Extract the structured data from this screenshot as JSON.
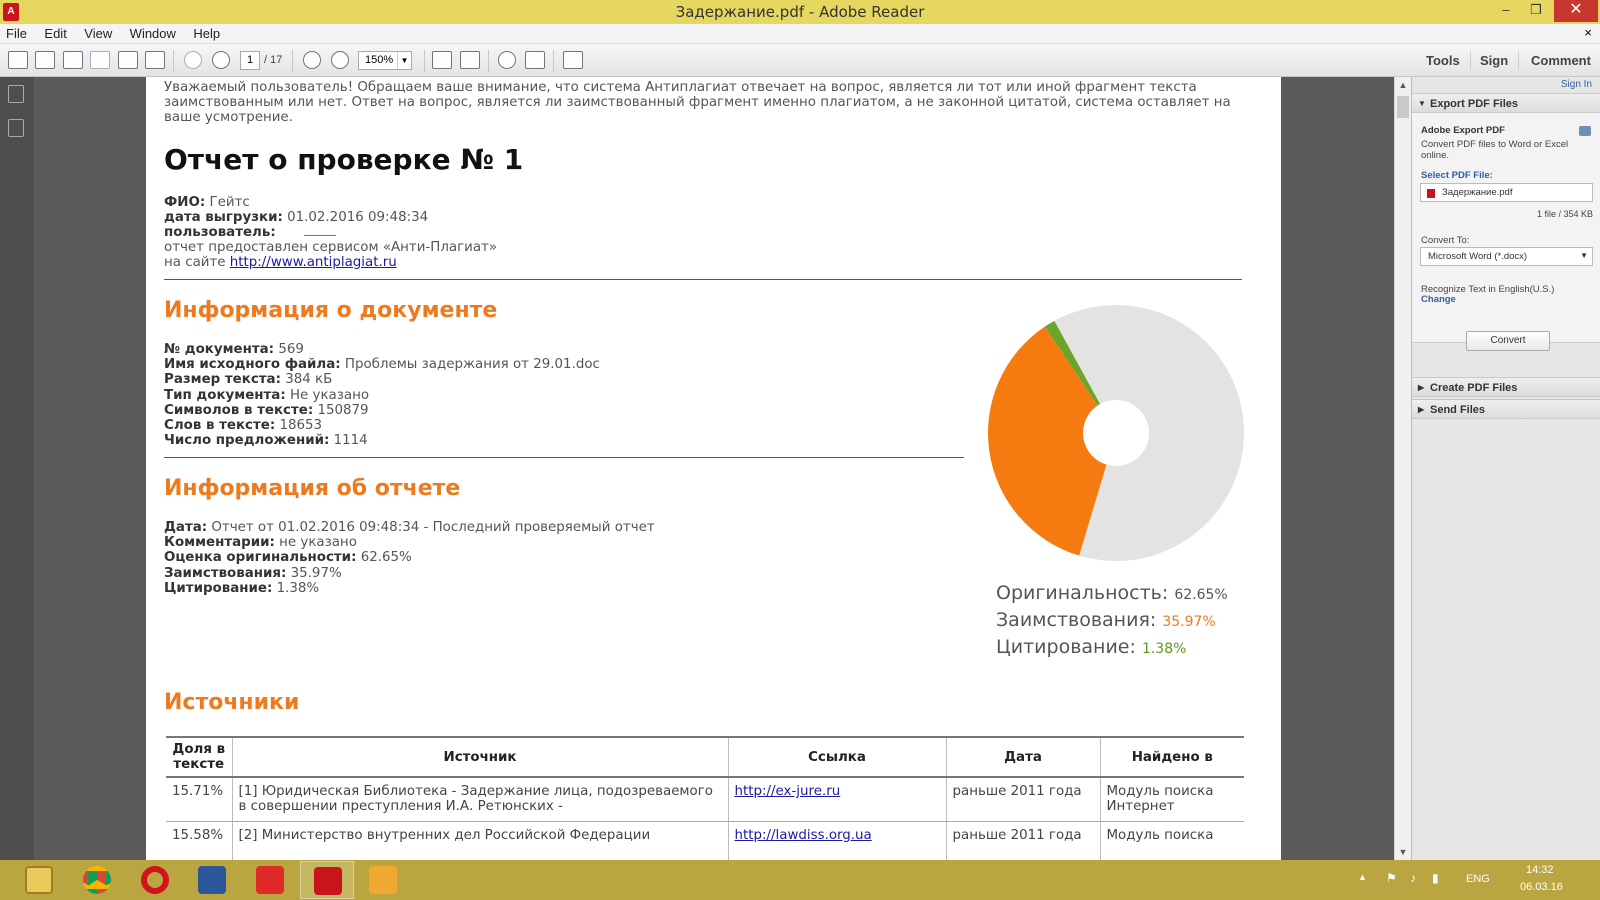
{
  "window": {
    "title": "Задержание.pdf - Adobe Reader",
    "app_icon": "A",
    "minimize": "–",
    "maximize": "❐",
    "close": "✕"
  },
  "menu": {
    "items": [
      "File",
      "Edit",
      "View",
      "Window",
      "Help"
    ],
    "doc_close": "×"
  },
  "toolbar": {
    "page_current": "1",
    "page_total": "/ 17",
    "zoom": "150%",
    "tools_label": "Tools",
    "sign_label": "Sign",
    "comment_label": "Comment"
  },
  "document": {
    "notice": "Уважаемый пользователь! Обращаем ваше внимание, что система Антиплагиат отвечает на вопрос, является ли тот или иной фрагмент текста заимствованным или нет. Ответ на вопрос, является ли заимствованный фрагмент именно плагиатом, а не законной цитатой, система оставляет на ваше усмотрение.",
    "title": "Отчет о проверке № 1",
    "meta": [
      {
        "label": "ФИО:",
        "value": "Гейтс"
      },
      {
        "label": "дата выгрузки:",
        "value": "01.02.2016 09:48:34"
      },
      {
        "label": "пользователь:",
        "value": ""
      }
    ],
    "provided_by": "отчет предоставлен сервисом «Анти-Плагиат»",
    "site_prefix": "на сайте",
    "site_link": "http://www.antiplagiat.ru",
    "doc_info": {
      "heading": "Информация о документе",
      "rows": [
        {
          "label": "№ документа:",
          "value": "569"
        },
        {
          "label": "Имя исходного файла:",
          "value": "Проблемы задержания от 29.01.doc"
        },
        {
          "label": "Размер текста:",
          "value": "384 кБ"
        },
        {
          "label": "Тип документа:",
          "value": "Не указано"
        },
        {
          "label": "Символов в тексте:",
          "value": "150879"
        },
        {
          "label": "Слов в тексте:",
          "value": "18653"
        },
        {
          "label": "Число предложений:",
          "value": "1114"
        }
      ]
    },
    "report_info": {
      "heading": "Информация об отчете",
      "rows": [
        {
          "label": "Дата:",
          "value": "Отчет от 01.02.2016 09:48:34 - Последний проверяемый отчет"
        },
        {
          "label": "Комментарии:",
          "value": "не указано"
        },
        {
          "label": "Оценка оригинальности:",
          "value": "62.65%"
        },
        {
          "label": "Заимствования:",
          "value": "35.97%"
        },
        {
          "label": "Цитирование:",
          "value": "1.38%"
        }
      ]
    },
    "chart_legend": [
      {
        "label": "Оригинальность:",
        "value": "62.65%"
      },
      {
        "label": "Заимствования:",
        "value": "35.97%"
      },
      {
        "label": "Цитирование:",
        "value": "1.38%"
      }
    ],
    "sources": {
      "heading": "Источники",
      "columns": [
        "Доля в тексте",
        "Источник",
        "Ссылка",
        "Дата",
        "Найдено в"
      ],
      "rows": [
        {
          "share": "15.71%",
          "source": "[1] Юридическая Библиотека - Задержание лица, подозреваемого в совершении преступления И.А. Ретюнских -",
          "link": "http://ex-jure.ru",
          "date": "раньше 2011 года",
          "found": "Модуль поиска Интернет"
        },
        {
          "share": "15.58%",
          "source": "[2] Министерство внутренних дел Российской Федерации",
          "link": "http://lawdiss.org.ua",
          "date": "раньше 2011 года",
          "found": "Модуль поиска"
        }
      ]
    }
  },
  "chart_data": {
    "type": "pie",
    "categories": [
      "Оригинальность",
      "Заимствования",
      "Цитирование"
    ],
    "values": [
      62.65,
      35.97,
      1.38
    ],
    "colors": [
      "#e3e3e3",
      "#f57b10",
      "#6aa52a"
    ],
    "donut": true
  },
  "right_panel": {
    "sign_in": "Sign In",
    "export_heading": "Export PDF Files",
    "export_title": "Adobe Export PDF",
    "export_desc": "Convert PDF files to Word or Excel online.",
    "select_label": "Select PDF File:",
    "file_name": "Задержание.pdf",
    "file_info": "1 file / 354 KB",
    "convert_to_label": "Convert To:",
    "convert_to_value": "Microsoft Word (*.docx)",
    "recognize_text": "Recognize Text in English(U.S.)",
    "change_label": "Change",
    "convert_button": "Convert",
    "create_heading": "Create PDF Files",
    "send_heading": "Send Files"
  },
  "taskbar": {
    "apps": [
      "file-explorer-icon",
      "chrome-icon",
      "opera-icon",
      "word-icon",
      "app-red-icon",
      "acrobat-icon",
      "outlook-icon"
    ],
    "language": "ENG",
    "time": "14:32",
    "date": "06.03.16"
  }
}
